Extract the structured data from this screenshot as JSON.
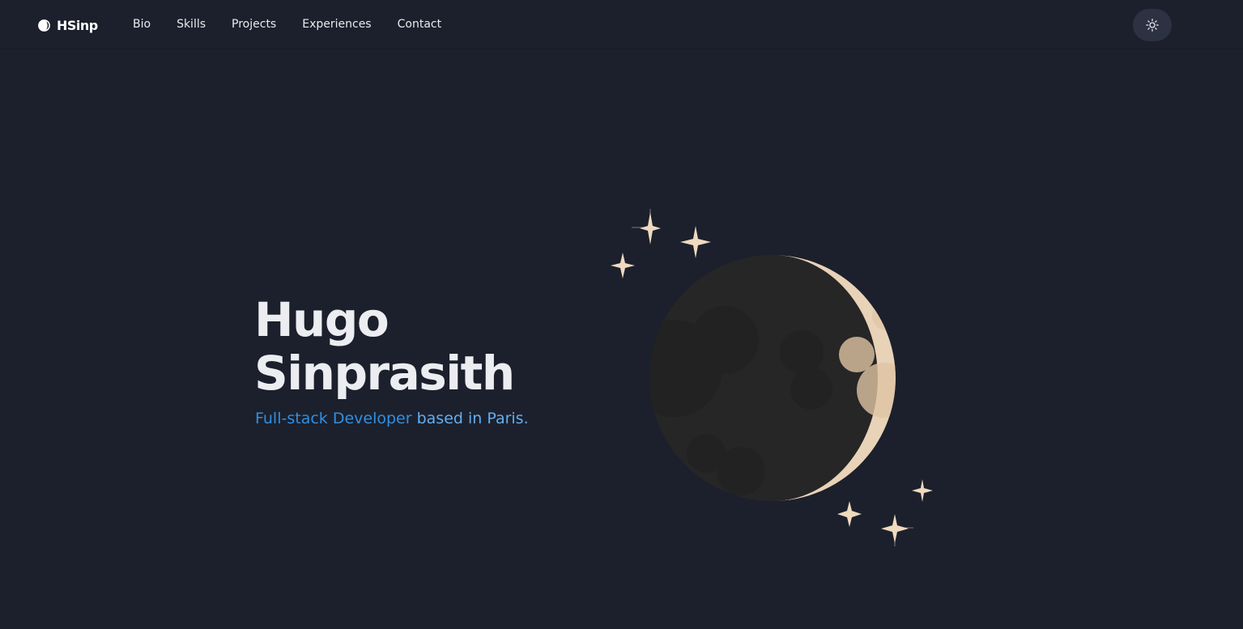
{
  "brand": {
    "name": "HSinp",
    "icon": "half-moon-icon"
  },
  "nav": {
    "items": [
      {
        "label": "Bio"
      },
      {
        "label": "Skills"
      },
      {
        "label": "Projects"
      },
      {
        "label": "Experiences"
      },
      {
        "label": "Contact"
      }
    ]
  },
  "theme_toggle": {
    "icon": "sun-icon"
  },
  "hero": {
    "first_name": "Hugo",
    "last_name": "Sinprasith",
    "subtitle_accent": "Full-stack Developer",
    "subtitle_rest": "based in Paris."
  },
  "illustration": {
    "icon": "crescent-moon-with-stars",
    "colors": {
      "moon_dark": "#262626",
      "moon_light": "#e8d2b8",
      "star": "#efd9bf"
    }
  },
  "colors": {
    "background": "#1c202c",
    "toggle_background": "#2c3242",
    "accent": "#2f8fe3",
    "heading": "#ebedf1"
  }
}
